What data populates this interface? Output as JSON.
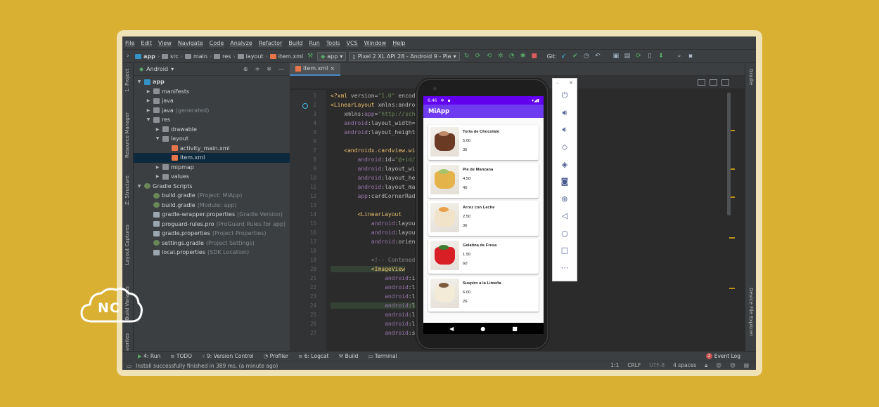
{
  "menu": [
    "File",
    "Edit",
    "View",
    "Navigate",
    "Code",
    "Analyze",
    "Refactor",
    "Build",
    "Run",
    "Tools",
    "VCS",
    "Window",
    "Help"
  ],
  "breadcrumbs": [
    "app",
    "src",
    "main",
    "res",
    "layout",
    "item.xml"
  ],
  "run_config": "app",
  "device": "Pixel 2 XL API 28 - Android 9 - Pie",
  "git_label": "Git:",
  "left_tool_tabs": [
    "1: Project",
    "Resource Manager",
    "Z: Structure",
    "Layout Captures",
    "Build Variants",
    "Favorites"
  ],
  "right_tool_tabs": [
    "Gradle",
    "Device File Explorer"
  ],
  "project": {
    "view_label": "Android",
    "tree": [
      {
        "label": "app",
        "sub": "",
        "indent": 0,
        "arrow": "▼",
        "icon": "mod"
      },
      {
        "label": "manifests",
        "sub": "",
        "indent": 1,
        "arrow": "▶",
        "icon": "fold"
      },
      {
        "label": "java",
        "sub": "",
        "indent": 1,
        "arrow": "▶",
        "icon": "fold"
      },
      {
        "label": "java",
        "sub": "(generated)",
        "indent": 1,
        "arrow": "▶",
        "icon": "fold"
      },
      {
        "label": "res",
        "sub": "",
        "indent": 1,
        "arrow": "▼",
        "icon": "fold"
      },
      {
        "label": "drawable",
        "sub": "",
        "indent": 2,
        "arrow": "▶",
        "icon": "fold"
      },
      {
        "label": "layout",
        "sub": "",
        "indent": 2,
        "arrow": "▼",
        "icon": "fold"
      },
      {
        "label": "activity_main.xml",
        "sub": "",
        "indent": 3,
        "arrow": "",
        "icon": "xml"
      },
      {
        "label": "item.xml",
        "sub": "",
        "indent": 3,
        "arrow": "",
        "icon": "xml",
        "selected": true
      },
      {
        "label": "mipmap",
        "sub": "",
        "indent": 2,
        "arrow": "▶",
        "icon": "fold"
      },
      {
        "label": "values",
        "sub": "",
        "indent": 2,
        "arrow": "▶",
        "icon": "fold"
      },
      {
        "label": "Gradle Scripts",
        "sub": "",
        "indent": 0,
        "arrow": "▼",
        "icon": "grad"
      },
      {
        "label": "build.gradle",
        "sub": "(Project: MiApp)",
        "indent": 1,
        "arrow": "",
        "icon": "grad"
      },
      {
        "label": "build.gradle",
        "sub": "(Module: app)",
        "indent": 1,
        "arrow": "",
        "icon": "grad"
      },
      {
        "label": "gradle-wrapper.properties",
        "sub": "(Gradle Version)",
        "indent": 1,
        "arrow": "",
        "icon": "prop"
      },
      {
        "label": "proguard-rules.pro",
        "sub": "(ProGuard Rules for app)",
        "indent": 1,
        "arrow": "",
        "icon": "prop"
      },
      {
        "label": "gradle.properties",
        "sub": "(Project Properties)",
        "indent": 1,
        "arrow": "",
        "icon": "prop"
      },
      {
        "label": "settings.gradle",
        "sub": "(Project Settings)",
        "indent": 1,
        "arrow": "",
        "icon": "grad"
      },
      {
        "label": "local.properties",
        "sub": "(SDK Location)",
        "indent": 1,
        "arrow": "",
        "icon": "prop"
      }
    ]
  },
  "editor": {
    "tab": "item.xml",
    "line_numbers": [
      "1",
      "2",
      "3",
      "4",
      "5",
      "6",
      "7",
      "8",
      "9",
      "10",
      "11",
      "12",
      "13",
      "14",
      "15",
      "16",
      "17",
      "18",
      "19",
      "20",
      "21",
      "22",
      "23",
      "24",
      "25",
      "26",
      "27"
    ],
    "lines": [
      [
        [
          "tag",
          "<?xml "
        ],
        [
          "attr",
          "version="
        ],
        [
          "val",
          "\"1.0\" "
        ],
        [
          "attr",
          "encoding"
        ]
      ],
      [
        [
          "tag",
          "<LinearLayout "
        ],
        [
          "attr",
          "xmlns:android"
        ]
      ],
      [
        [
          "attr",
          "    xmlns:"
        ],
        [
          "ns",
          "app"
        ],
        [
          "attr",
          "="
        ],
        [
          "val",
          "\"http://schema"
        ]
      ],
      [
        [
          "ns",
          "    android"
        ],
        [
          "attr",
          ":layout_width="
        ],
        [
          "val",
          "\"ma"
        ]
      ],
      [
        [
          "ns",
          "    android"
        ],
        [
          "attr",
          ":layout_height="
        ],
        [
          "val",
          "\"w"
        ]
      ],
      [
        [
          "attr",
          ""
        ]
      ],
      [
        [
          "tag",
          "    <androidx.cardview.widge"
        ]
      ],
      [
        [
          "ns",
          "        android"
        ],
        [
          "attr",
          ":id="
        ],
        [
          "val",
          "\"@+id/ca"
        ]
      ],
      [
        [
          "ns",
          "        android"
        ],
        [
          "attr",
          ":layout_width"
        ]
      ],
      [
        [
          "ns",
          "        android"
        ],
        [
          "attr",
          ":layout_heig"
        ]
      ],
      [
        [
          "ns",
          "        android"
        ],
        [
          "attr",
          ":layout_marg"
        ]
      ],
      [
        [
          "ns",
          "        app"
        ],
        [
          "attr",
          ":cardCornerRadiu"
        ]
      ],
      [
        [
          "attr",
          ""
        ]
      ],
      [
        [
          "tag",
          "        <LinearLayout"
        ]
      ],
      [
        [
          "ns",
          "            android"
        ],
        [
          "attr",
          ":layout_w"
        ]
      ],
      [
        [
          "ns",
          "            android"
        ],
        [
          "attr",
          ":layout_h"
        ]
      ],
      [
        [
          "ns",
          "            android"
        ],
        [
          "attr",
          ":orienta"
        ]
      ],
      [
        [
          "attr",
          ""
        ]
      ],
      [
        [
          "cmt",
          "            <!-- Contenedor"
        ]
      ],
      [
        [
          "tag",
          "            <ImageView"
        ]
      ],
      [
        [
          "ns",
          "                android"
        ],
        [
          "attr",
          ":id="
        ]
      ],
      [
        [
          "ns",
          "                android"
        ],
        [
          "attr",
          ":lay"
        ]
      ],
      [
        [
          "ns",
          "                android"
        ],
        [
          "attr",
          ":lay"
        ]
      ],
      [
        [
          "ns",
          "                android"
        ],
        [
          "attr",
          ":lay"
        ]
      ],
      [
        [
          "ns",
          "                android"
        ],
        [
          "attr",
          ":lay"
        ]
      ],
      [
        [
          "ns",
          "                android"
        ],
        [
          "attr",
          ":lay"
        ]
      ],
      [
        [
          "ns",
          "                android"
        ],
        [
          "attr",
          ":sca"
        ]
      ]
    ]
  },
  "bottom_tools": [
    "4: Run",
    "TODO",
    "9: Version Control",
    "Profiler",
    "6: Logcat",
    "Build",
    "Terminal"
  ],
  "event_log": {
    "count": "2",
    "label": "Event Log"
  },
  "status": {
    "message": "Install successfully finished in 389 ms. (a minute ago)",
    "position": "1:1",
    "line_sep": "CRLF",
    "encoding": "UTF-8",
    "indent": "4 spaces"
  },
  "phone": {
    "time": "6:46",
    "app_title": "MiApp",
    "items": [
      {
        "name": "Torta de Chocolate",
        "price": "5.00",
        "qty": "35",
        "color": "#6b3a24",
        "accent": "#c08a6a"
      },
      {
        "name": "Pie de Manzana",
        "price": "4.50",
        "qty": "45",
        "color": "#e4b34a",
        "accent": "#a4c36a"
      },
      {
        "name": "Arroz con Leche",
        "price": "2.50",
        "qty": "36",
        "color": "#f1e3c8",
        "accent": "#e9a24b"
      },
      {
        "name": "Gelatina de Fresa",
        "price": "1.50",
        "qty": "60",
        "color": "#d81f26",
        "accent": "#3c7d2f"
      },
      {
        "name": "Suspiro a la Limeña",
        "price": "6.00",
        "qty": "26",
        "color": "#f3ead8",
        "accent": "#7d5b3d"
      }
    ]
  },
  "emulator_icons": [
    "power-icon",
    "volume-up-icon",
    "volume-down-icon",
    "rotate-left-icon",
    "rotate-right-icon",
    "camera-icon",
    "zoom-icon",
    "back-icon",
    "home-icon",
    "overview-icon",
    "more-icon"
  ],
  "logo_text": "NC",
  "colors": {
    "background": "#d9b032",
    "accent": "#6200ee"
  }
}
